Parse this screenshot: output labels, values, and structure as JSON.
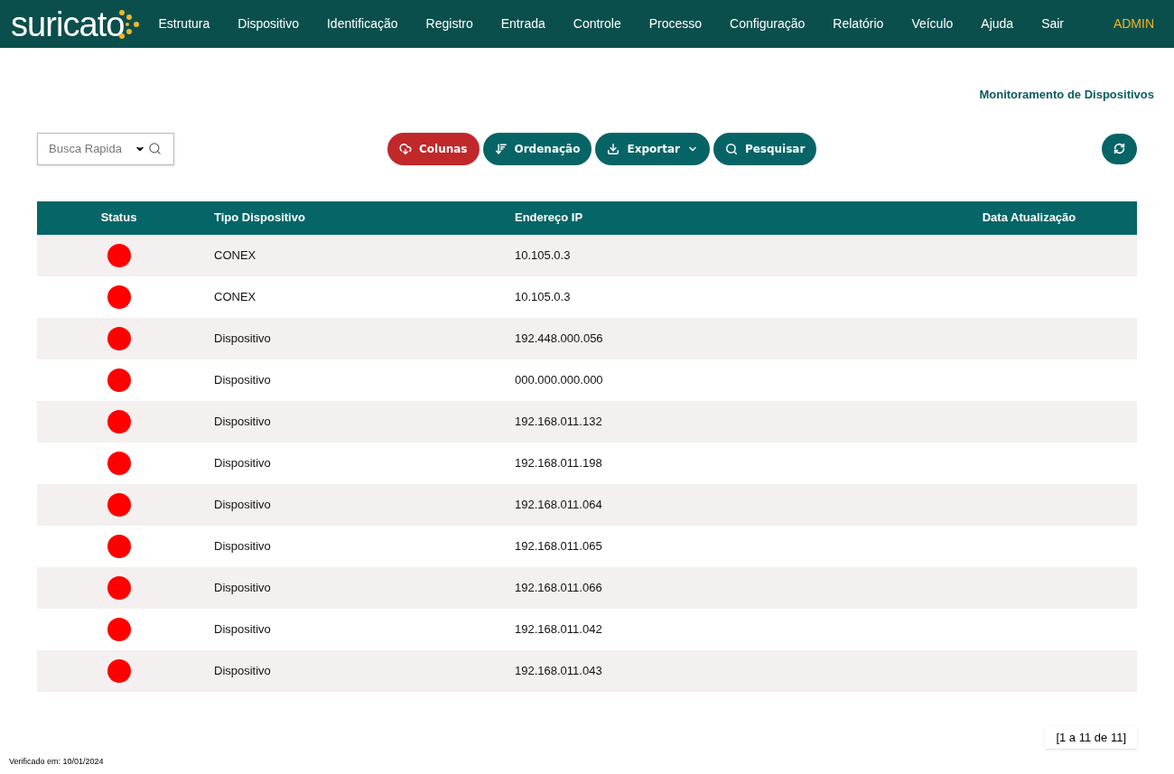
{
  "navbar": {
    "logo": "suricato",
    "items": [
      "Estrutura",
      "Dispositivo",
      "Identificação",
      "Registro",
      "Entrada",
      "Controle",
      "Processo",
      "Configuração",
      "Relatório",
      "Veículo",
      "Ajuda",
      "Sair"
    ],
    "user": "ADMIN"
  },
  "page_title": "Monitoramento de Dispositivos",
  "search": {
    "placeholder": "Busca Rapida"
  },
  "toolbar": [
    {
      "kind": "columns",
      "label": "Colunas",
      "color": "#c0282a"
    },
    {
      "kind": "sort",
      "label": "Ordenação",
      "color": "#076466"
    },
    {
      "kind": "export",
      "label": "Exportar",
      "color": "#076466"
    },
    {
      "kind": "search",
      "label": "Pesquisar",
      "color": "#076466"
    }
  ],
  "table": {
    "columns": [
      "Status",
      "Tipo Dispositivo",
      "Endereço IP",
      "Data Atualização"
    ],
    "rows": [
      {
        "color": "#ff0000",
        "type": "CONEX",
        "ip": "10.105.0.3"
      },
      {
        "color": "#ff0000",
        "type": "CONEX",
        "ip": "10.105.0.3"
      },
      {
        "color": "#ff0000",
        "type": "Dispositivo",
        "ip": "192.448.000.056"
      },
      {
        "color": "#ff0000",
        "type": "Dispositivo",
        "ip": "000.000.000.000"
      },
      {
        "color": "#ff0000",
        "type": "Dispositivo",
        "ip": "192.168.011.132"
      },
      {
        "color": "#ff0000",
        "type": "Dispositivo",
        "ip": "192.168.011.198"
      },
      {
        "color": "#ff0000",
        "type": "Dispositivo",
        "ip": "192.168.011.064"
      },
      {
        "color": "#ff0000",
        "type": "Dispositivo",
        "ip": "192.168.011.065"
      },
      {
        "color": "#ff0000",
        "type": "Dispositivo",
        "ip": "192.168.011.066"
      },
      {
        "color": "#ff0000",
        "type": "Dispositivo",
        "ip": "192.168.011.042"
      },
      {
        "color": "#ff0000",
        "type": "Dispositivo",
        "ip": "192.168.011.043"
      }
    ]
  },
  "pagination": "[1 a 11 de 11]",
  "footer": "Verificado em: 10/01/2024"
}
